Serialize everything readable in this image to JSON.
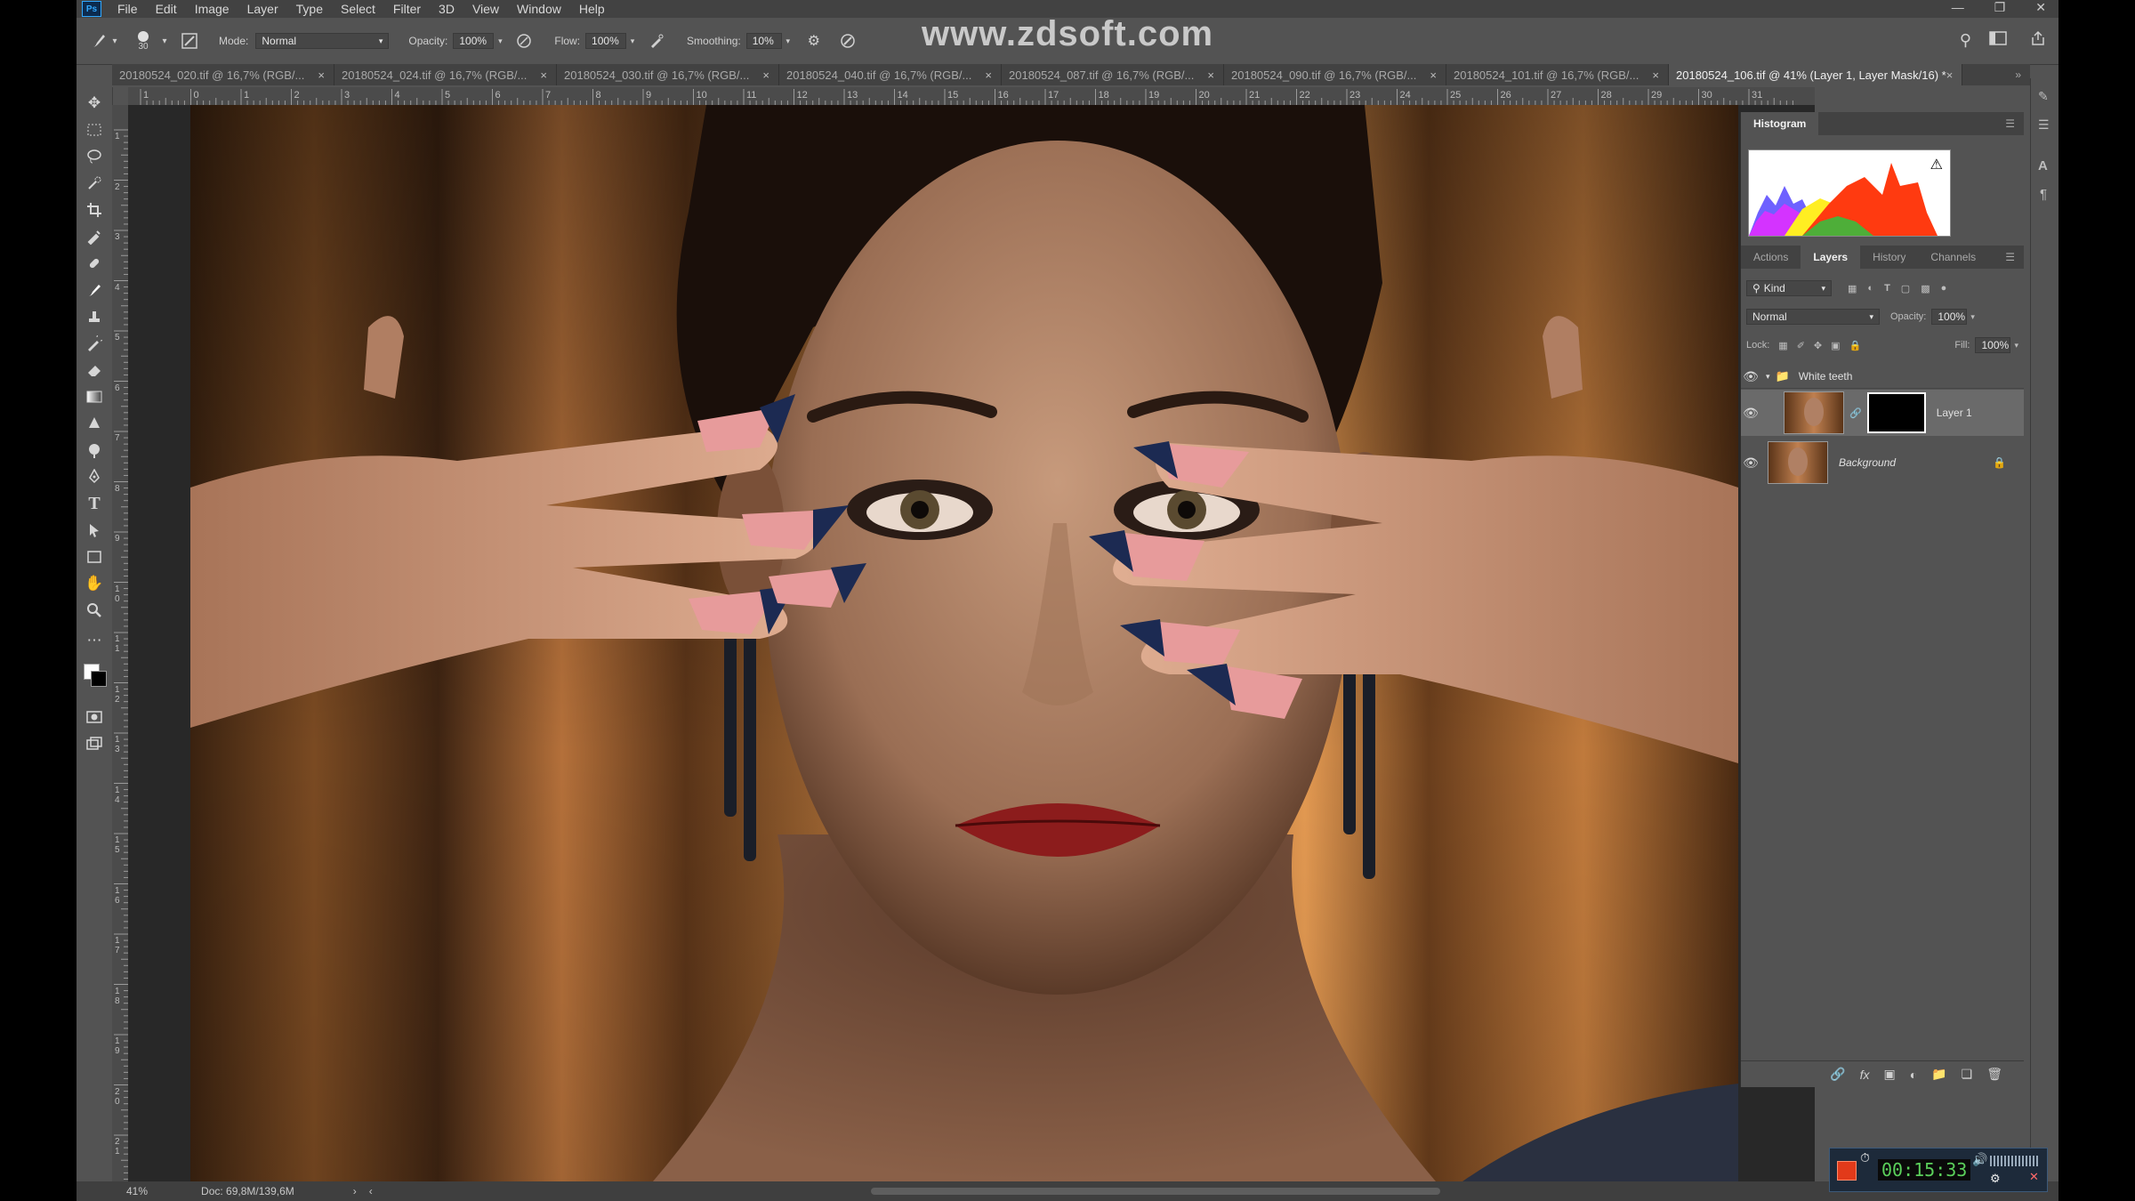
{
  "menu": [
    "File",
    "Edit",
    "Image",
    "Layer",
    "Type",
    "Select",
    "Filter",
    "3D",
    "View",
    "Window",
    "Help"
  ],
  "app_logo": "Ps",
  "options": {
    "brush_size": "30",
    "mode_label": "Mode:",
    "mode_value": "Normal",
    "opacity_label": "Opacity:",
    "opacity_value": "100%",
    "flow_label": "Flow:",
    "flow_value": "100%",
    "smoothing_label": "Smoothing:",
    "smoothing_value": "10%"
  },
  "watermark": "www.zdsoft.com",
  "tabs": [
    "20180524_020.tif @ 16,7% (RGB/...",
    "20180524_024.tif @ 16,7% (RGB/...",
    "20180524_030.tif @ 16,7% (RGB/...",
    "20180524_040.tif @ 16,7% (RGB/...",
    "20180524_087.tif @ 16,7% (RGB/...",
    "20180524_090.tif @ 16,7% (RGB/...",
    "20180524_101.tif @ 16,7% (RGB/...",
    "20180524_106.tif @ 41% (Layer 1, Layer Mask/16) *"
  ],
  "ruler_h": [
    "1",
    "0",
    "1",
    "2",
    "3",
    "4",
    "5",
    "6",
    "7",
    "8",
    "9",
    "10",
    "11",
    "12",
    "13",
    "14",
    "15",
    "16",
    "17",
    "18",
    "19",
    "20",
    "21",
    "22",
    "23",
    "24",
    "25",
    "26",
    "27",
    "28",
    "29",
    "30",
    "31"
  ],
  "ruler_v": [
    "1",
    "2",
    "3",
    "4",
    "5",
    "6",
    "7",
    "8",
    "9",
    "10",
    "11",
    "12",
    "13",
    "14",
    "15",
    "16",
    "17",
    "18",
    "19",
    "20",
    "21"
  ],
  "status": {
    "zoom": "41%",
    "doc": "Doc: 69,8M/139,6M"
  },
  "panels": {
    "histogram_tab": "Histogram",
    "layer_tabs": [
      "Actions",
      "Layers",
      "History",
      "Channels"
    ],
    "kind_label": "Kind",
    "blend_mode": "Normal",
    "opacity_label": "Opacity:",
    "opacity_value": "100%",
    "lock_label": "Lock:",
    "fill_label": "Fill:",
    "fill_value": "100%",
    "layers": [
      {
        "name": "White teeth",
        "type": "group"
      },
      {
        "name": "Layer 1",
        "type": "masked"
      },
      {
        "name": "Background",
        "type": "locked"
      }
    ]
  },
  "tray": {
    "clock": "00:15:33"
  },
  "colors": {
    "accent": "#31a8ff",
    "panel": "#535353",
    "dark": "#424242",
    "backdrop": "#d58a3e"
  }
}
